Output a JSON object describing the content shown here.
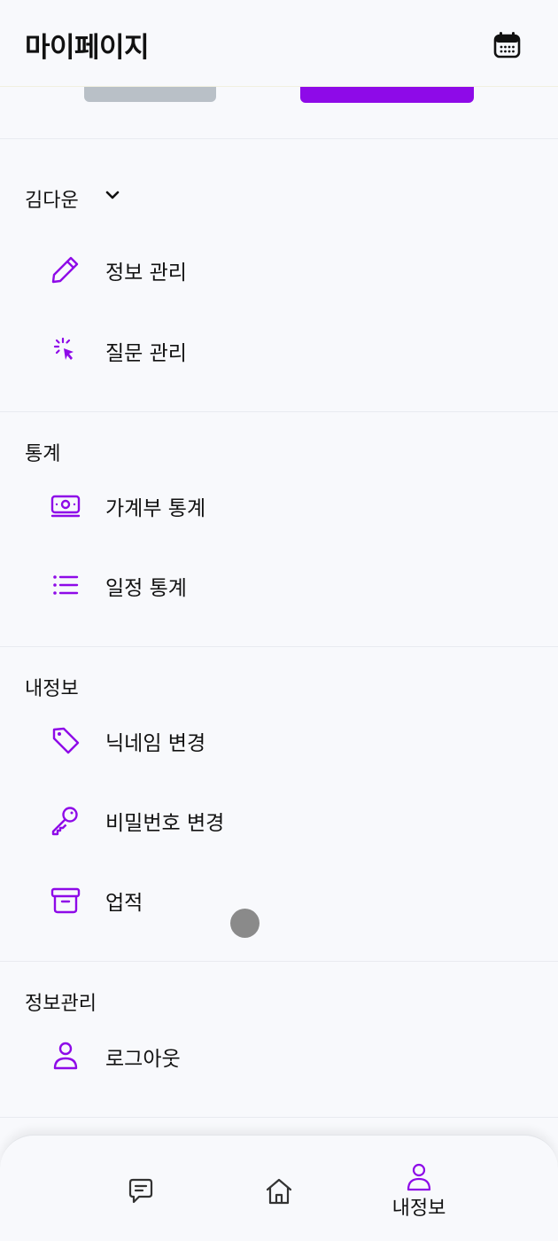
{
  "header": {
    "title": "마이페이지",
    "calendar_icon": "calendar-icon"
  },
  "colors": {
    "accent": "#8e0ae8",
    "tab_inactive": "#b9c0c7",
    "background": "#f8f9fc"
  },
  "sections": {
    "user": {
      "label": "김다운",
      "items": [
        {
          "label": "정보 관리",
          "icon": "pencil-icon"
        },
        {
          "label": "질문 관리",
          "icon": "cursor-click-icon"
        }
      ]
    },
    "stats": {
      "label": "통계",
      "items": [
        {
          "label": "가계부 통계",
          "icon": "money-icon"
        },
        {
          "label": "일정 통계",
          "icon": "list-icon"
        }
      ]
    },
    "my_info": {
      "label": "내정보",
      "items": [
        {
          "label": "닉네임 변경",
          "icon": "tag-icon"
        },
        {
          "label": "비밀번호 변경",
          "icon": "key-icon"
        },
        {
          "label": "업적",
          "icon": "archive-box-icon"
        }
      ]
    },
    "account": {
      "label": "정보관리",
      "items": [
        {
          "label": "로그아웃",
          "icon": "user-icon"
        }
      ]
    }
  },
  "bottom_nav": {
    "items": [
      {
        "icon": "chat-icon",
        "label": ""
      },
      {
        "icon": "home-icon",
        "label": ""
      },
      {
        "icon": "user-icon",
        "label": "내정보",
        "active": true
      }
    ]
  }
}
